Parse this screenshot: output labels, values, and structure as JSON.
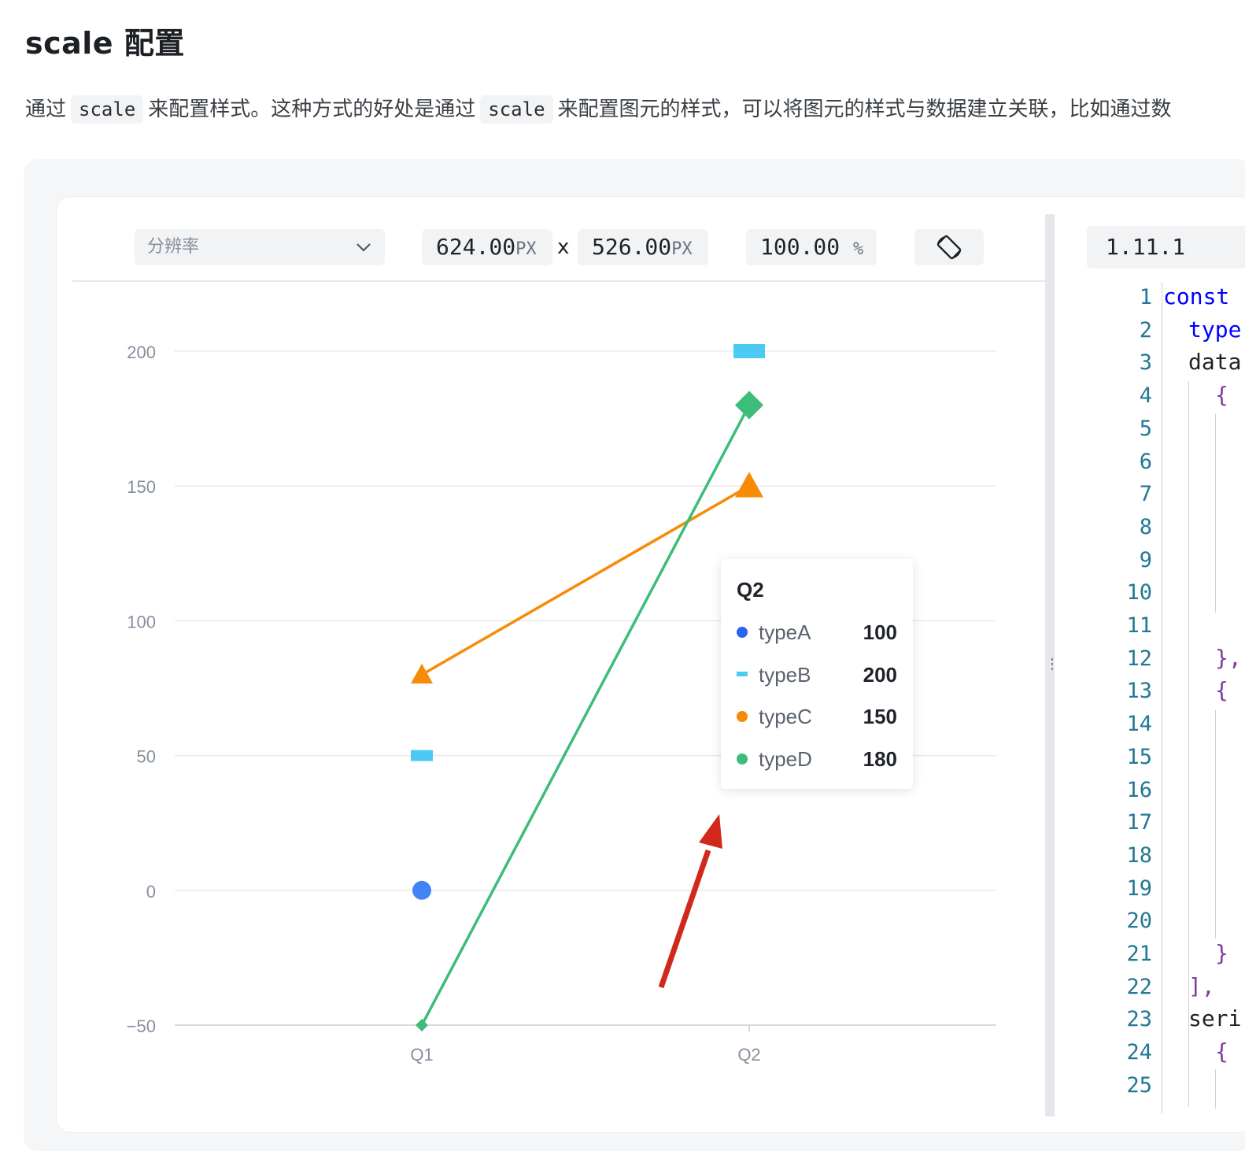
{
  "page": {
    "title": "scale 配置",
    "description": {
      "part1": "通过",
      "code1": "scale",
      "part2": "来配置样式。这种方式的好处是通过",
      "code2": "scale",
      "part3": "来配置图元的样式，可以将图元的样式与数据建立关联，比如通过数"
    }
  },
  "toolbar": {
    "resolution_placeholder": "分辨率",
    "width_value": "624.00",
    "width_unit": "PX",
    "times": "x",
    "height_value": "526.00",
    "height_unit": "PX",
    "zoom_value": "100.00",
    "zoom_unit": "%",
    "version": "1.11.1",
    "icons": {
      "dropdown": "chevron-down-icon",
      "rotate": "rotate-screen-icon",
      "grip": "drag-handle-icon"
    }
  },
  "editor": {
    "line_numbers": [
      "1",
      "2",
      "3",
      "4",
      "5",
      "6",
      "7",
      "8",
      "9",
      "10",
      "11",
      "12",
      "13",
      "14",
      "15",
      "16",
      "17",
      "18",
      "19",
      "20",
      "21",
      "22",
      "23",
      "24",
      "25"
    ],
    "visible_code": {
      "l1": "const",
      "l2": "type",
      "l3": "data",
      "l4": "{",
      "l12": "},",
      "l13": "{",
      "l21": "}",
      "l22": "],",
      "l23": "seri",
      "l24": "{"
    }
  },
  "chart_data": {
    "type": "line",
    "categories": [
      "Q1",
      "Q2"
    ],
    "ylim": [
      -50,
      200
    ],
    "yticks": [
      "200",
      "150",
      "100",
      "50",
      "0",
      "−50"
    ],
    "grid": true,
    "series": [
      {
        "name": "typeA",
        "values": [
          0,
          100
        ],
        "color": "#4284f5",
        "shape": "circle",
        "line": false
      },
      {
        "name": "typeB",
        "values": [
          50,
          200
        ],
        "color": "#4dc9f6",
        "shape": "rect",
        "line": false
      },
      {
        "name": "typeC",
        "values": [
          80,
          150
        ],
        "color": "#f58b07",
        "shape": "triangle",
        "line": true
      },
      {
        "name": "typeD",
        "values": [
          -50,
          180
        ],
        "color": "#3dbc7a",
        "shape": "diamond",
        "line": true
      }
    ],
    "tooltip": {
      "title": "Q2",
      "rows": [
        {
          "name": "typeA",
          "value": "100",
          "color": "#2864f0",
          "marker": "dot"
        },
        {
          "name": "typeB",
          "value": "200",
          "color": "#4dc9f6",
          "marker": "dash"
        },
        {
          "name": "typeC",
          "value": "150",
          "color": "#f58b07",
          "marker": "dot"
        },
        {
          "name": "typeD",
          "value": "180",
          "color": "#3dbc7a",
          "marker": "dot"
        }
      ]
    },
    "annotation_arrow_color": "#d0291c"
  }
}
